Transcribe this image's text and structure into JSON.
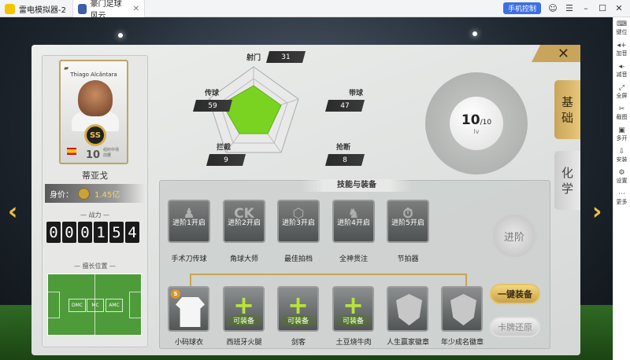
{
  "titlebar": {
    "tab1": "雷电模拟器-2",
    "tab2": "豪门足球风云",
    "phone_control": "手机控制"
  },
  "sidebar": [
    {
      "icon": "keyboard-icon",
      "glyph": "⌨",
      "label": "键位"
    },
    {
      "icon": "volume-up-icon",
      "glyph": "◂+",
      "label": "加音"
    },
    {
      "icon": "volume-down-icon",
      "glyph": "◂-",
      "label": "减音"
    },
    {
      "icon": "fullscreen-icon",
      "glyph": "⤢",
      "label": "全屏"
    },
    {
      "icon": "screenshot-icon",
      "glyph": "✂",
      "label": "截图"
    },
    {
      "icon": "multi-open-icon",
      "glyph": "▣",
      "label": "多开"
    },
    {
      "icon": "install-icon",
      "glyph": "⇩",
      "label": "安装"
    },
    {
      "icon": "settings-icon",
      "glyph": "⚙",
      "label": "设置"
    },
    {
      "icon": "more-icon",
      "glyph": "⋯",
      "label": "更多"
    }
  ],
  "player": {
    "card_name": "Thiago Alcântara",
    "card_rating": "10",
    "card_position": "组织中场\n前腰",
    "badge": "SS",
    "name": "蒂亚戈",
    "worth_label": "身价：",
    "worth_value": "1.45亿",
    "power_label": "战力",
    "power_digits": [
      "0",
      "0",
      "0",
      "1",
      "5",
      "4"
    ],
    "position_label": "擅长位置",
    "positions": [
      "DMC",
      "MC",
      "AMC"
    ]
  },
  "stats": {
    "shot_label": "射门",
    "shot": "31",
    "pass_label": "传球",
    "pass": "59",
    "dribble_label": "带球",
    "dribble": "47",
    "intercept_label": "拦截",
    "intercept": "9",
    "tackle_label": "抢断",
    "tackle": "8"
  },
  "level": {
    "value": "10",
    "max": "/10",
    "unit": "lv"
  },
  "tabs": {
    "basic": [
      "基",
      "础"
    ],
    "chem": [
      "化",
      "学"
    ]
  },
  "skills": {
    "title": "技能与装备",
    "items": [
      {
        "glyph": "♟",
        "lock": "进阶1开启",
        "name": "手术刀传球"
      },
      {
        "glyph": "CK",
        "lock": "进阶2开启",
        "name": "角球大师"
      },
      {
        "glyph": "⬡",
        "lock": "进阶3开启",
        "name": "最佳拍档"
      },
      {
        "glyph": "♞",
        "lock": "进阶4开启",
        "name": "全神贯注"
      },
      {
        "glyph": "⏱",
        "lock": "进阶5开启",
        "name": "节拍器"
      }
    ],
    "equipment": [
      {
        "type": "shirt",
        "tag": "",
        "name": "小码球衣"
      },
      {
        "type": "plus",
        "tag": "可装备",
        "name": "西班牙火腿"
      },
      {
        "type": "plus",
        "tag": "可装备",
        "name": "剑客"
      },
      {
        "type": "plus",
        "tag": "可装备",
        "name": "土豆烧牛肉"
      },
      {
        "type": "badge",
        "tag": "",
        "name": "人生赢家徽章"
      },
      {
        "type": "badge",
        "tag": "",
        "name": "年少成名徽章"
      }
    ],
    "shirt_badge": "S"
  },
  "buttons": {
    "advance": "进阶",
    "equip_all": "一键装备",
    "restore": "卡牌还原"
  },
  "colors": {
    "accent_gold": "#c9a55a",
    "radar_fill": "#7ad321",
    "equip_plus": "#b7e33b"
  }
}
